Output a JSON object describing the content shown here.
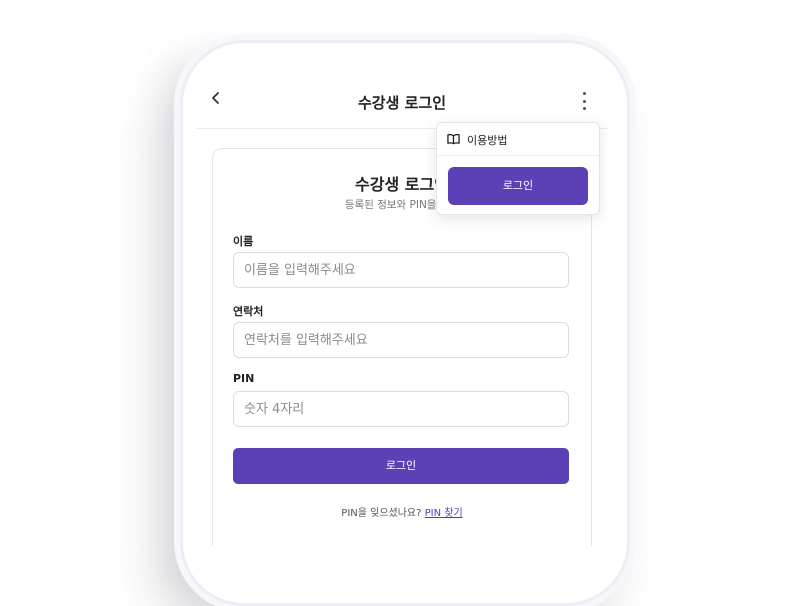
{
  "header": {
    "back_icon": "chevron-left-icon",
    "title": "수강생 로그인",
    "more_icon": "more-vertical-icon"
  },
  "card": {
    "title": "수강생 로그인",
    "subtitle": "등록된 정보와 PIN을 입력"
  },
  "form": {
    "name_label": "이름",
    "name_placeholder": "이름을 입력해주세요",
    "phone_label": "연락처",
    "phone_placeholder": "연락처를 입력해주세요",
    "pin_label": "PIN",
    "pin_placeholder": "숫자 4자리",
    "login_label": "로그인"
  },
  "forgot": {
    "text": "PIN을 잊으셨나요?",
    "link": "PIN 찾기"
  },
  "menu": {
    "guide_icon": "book-open-icon",
    "guide_label": "이용방법",
    "login_label": "로그인"
  },
  "colors": {
    "accent": "#5b41b5",
    "link": "#4b3cc4"
  }
}
